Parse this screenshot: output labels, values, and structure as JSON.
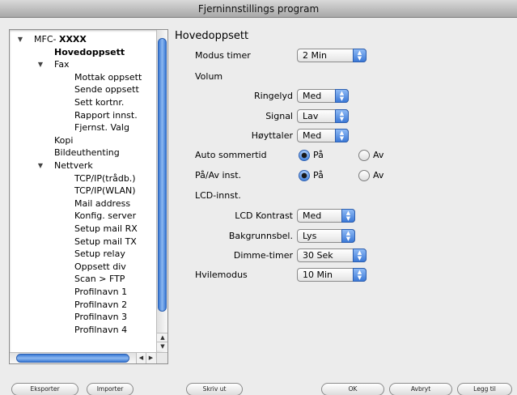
{
  "window": {
    "title": "Fjerninnstillings program"
  },
  "tree": {
    "items": [
      {
        "label": "MFC- XXXX",
        "level": 0,
        "expanded": true
      },
      {
        "label": "Hovedoppsett",
        "level": 1,
        "selected": true
      },
      {
        "label": "Fax",
        "level": 1,
        "expanded": true
      },
      {
        "label": "Mottak oppsett",
        "level": 2
      },
      {
        "label": "Sende oppsett",
        "level": 2
      },
      {
        "label": "Sett kortnr.",
        "level": 2
      },
      {
        "label": "Rapport innst.",
        "level": 2
      },
      {
        "label": "Fjernst. Valg",
        "level": 2
      },
      {
        "label": "Kopi",
        "level": 1
      },
      {
        "label": "Bildeuthenting",
        "level": 1
      },
      {
        "label": "Nettverk",
        "level": 1,
        "expanded": true
      },
      {
        "label": "TCP/IP(trådb.)",
        "level": 2
      },
      {
        "label": "TCP/IP(WLAN)",
        "level": 2
      },
      {
        "label": "Mail address",
        "level": 2
      },
      {
        "label": "Konfig. server",
        "level": 2
      },
      {
        "label": "Setup mail RX",
        "level": 2
      },
      {
        "label": "Setup mail TX",
        "level": 2
      },
      {
        "label": "Setup relay",
        "level": 2
      },
      {
        "label": "Oppsett  div",
        "level": 2
      },
      {
        "label": "Scan > FTP",
        "level": 2
      },
      {
        "label": "Profilnavn 1",
        "level": 2
      },
      {
        "label": "Profilnavn 2",
        "level": 2
      },
      {
        "label": "Profilnavn 3",
        "level": 2
      },
      {
        "label": "Profilnavn 4",
        "level": 2
      }
    ]
  },
  "main": {
    "section_title": "Hovedoppsett",
    "mode_timer": {
      "label": "Modus timer",
      "value": "2 Min"
    },
    "volume": {
      "label": "Volum",
      "ring": {
        "label": "Ringelyd",
        "value": "Med"
      },
      "signal": {
        "label": "Signal",
        "value": "Lav"
      },
      "speaker": {
        "label": "Høyttaler",
        "value": "Med"
      }
    },
    "auto_dst": {
      "label": "Auto sommertid",
      "on": "På",
      "off": "Av",
      "selected": "on"
    },
    "onoff": {
      "label": "På/Av inst.",
      "on": "På",
      "off": "Av",
      "selected": "on"
    },
    "lcd": {
      "label": "LCD-innst.",
      "contrast": {
        "label": "LCD Kontrast",
        "value": "Med"
      },
      "backlight": {
        "label": "Bakgrunnsbel.",
        "value": "Lys"
      },
      "dim_timer": {
        "label": "Dimme-timer",
        "value": "30 Sek"
      }
    },
    "sleep": {
      "label": "Hvilemodus",
      "value": "10 Min"
    }
  },
  "buttons": {
    "export": "Eksporter",
    "import": "Importer",
    "print": "Skriv ut",
    "ok": "OK",
    "cancel": "Avbryt",
    "apply": "Legg til"
  }
}
